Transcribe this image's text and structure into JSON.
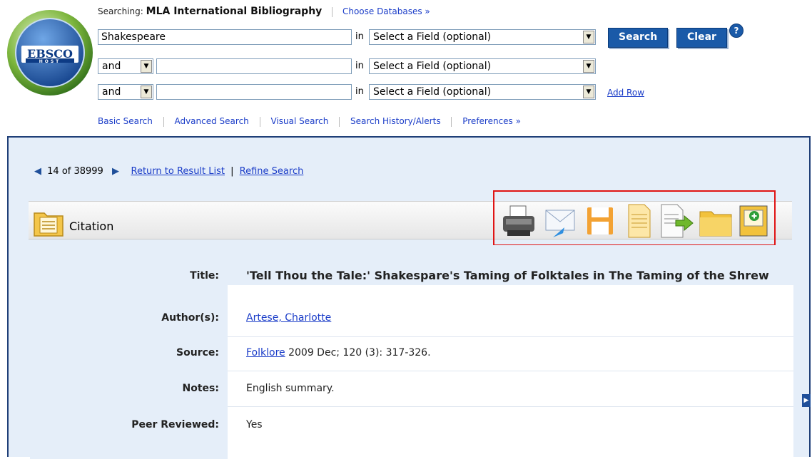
{
  "header": {
    "logo_label": "EBSCO",
    "logo_sub": "HOST",
    "searching_prefix": "Searching:",
    "database": "MLA International Bibliography",
    "choose_databases": "Choose Databases »"
  },
  "search": {
    "rows": [
      {
        "term": "Shakespeare",
        "operator": "",
        "in_label": "in",
        "field": "Select a Field (optional)"
      },
      {
        "term": "",
        "operator": "and",
        "in_label": "in",
        "field": "Select a Field (optional)"
      },
      {
        "term": "",
        "operator": "and",
        "in_label": "in",
        "field": "Select a Field (optional)"
      }
    ],
    "search_label": "Search",
    "clear_label": "Clear",
    "help_label": "?",
    "add_row": "Add Row"
  },
  "nav": {
    "basic": "Basic Search",
    "advanced": "Advanced Search",
    "visual": "Visual Search",
    "history": "Search History/Alerts",
    "preferences": "Preferences »"
  },
  "pager": {
    "position": "14 of 38999",
    "return": "Return to Result List",
    "sep": "|",
    "refine": "Refine Search"
  },
  "citation": {
    "heading": "Citation",
    "tools": [
      "print-icon",
      "email-icon",
      "save-icon",
      "cite-icon",
      "export-icon",
      "folder-icon",
      "add-to-folder-icon"
    ]
  },
  "record": {
    "title_label": "Title:",
    "title": "'Tell Thou the Tale:' Shakespare's Taming of Folktales in The Taming of the Shrew",
    "author_label": "Author(s):",
    "author": "Artese, Charlotte",
    "source_label": "Source:",
    "source_link": "Folklore",
    "source_rest": " 2009 Dec; 120 (3): 317-326.",
    "notes_label": "Notes:",
    "notes": "English summary.",
    "peer_label": "Peer Reviewed:",
    "peer": "Yes"
  },
  "colors": {
    "accent": "#1a5aa8",
    "panel_bg": "#e5eef9",
    "highlight_box": "#e01414",
    "link": "#1a3cc8"
  }
}
